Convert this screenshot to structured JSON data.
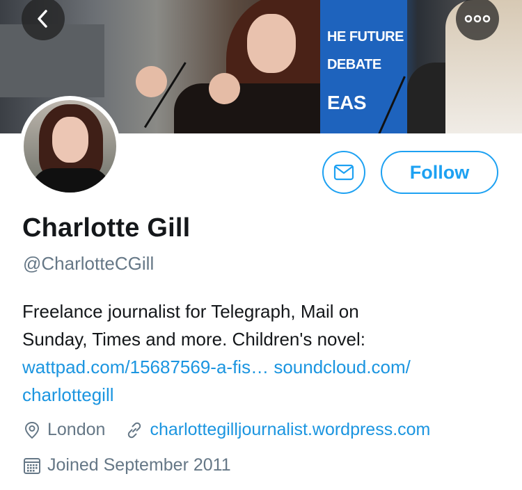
{
  "header": {
    "back_icon": "chevron-left-icon",
    "more_icon": "ellipsis-icon",
    "banner_sign_lines": [
      "HE FUTURE",
      "DEBATE",
      "EAS"
    ]
  },
  "profile": {
    "name": "Charlotte Gill",
    "handle": "@CharlotteCGill",
    "actions": {
      "message_icon": "envelope-icon",
      "follow_label": "Follow"
    },
    "bio": {
      "text_line1": "Freelance journalist for Telegraph, Mail on",
      "text_line2": "Sunday, Times and more. Children's novel:",
      "link1": "wattpad.com/15687569-a-fis…",
      "link2_part1": "soundcloud.com/",
      "link2_part2": "charlottegill"
    },
    "location": "London",
    "website": "charlottegilljournalist.wordpress.com",
    "joined": "Joined September 2011"
  },
  "colors": {
    "accent": "#1da1f2",
    "link": "#1b95e0",
    "secondary_text": "#657786",
    "primary_text": "#14171a"
  }
}
